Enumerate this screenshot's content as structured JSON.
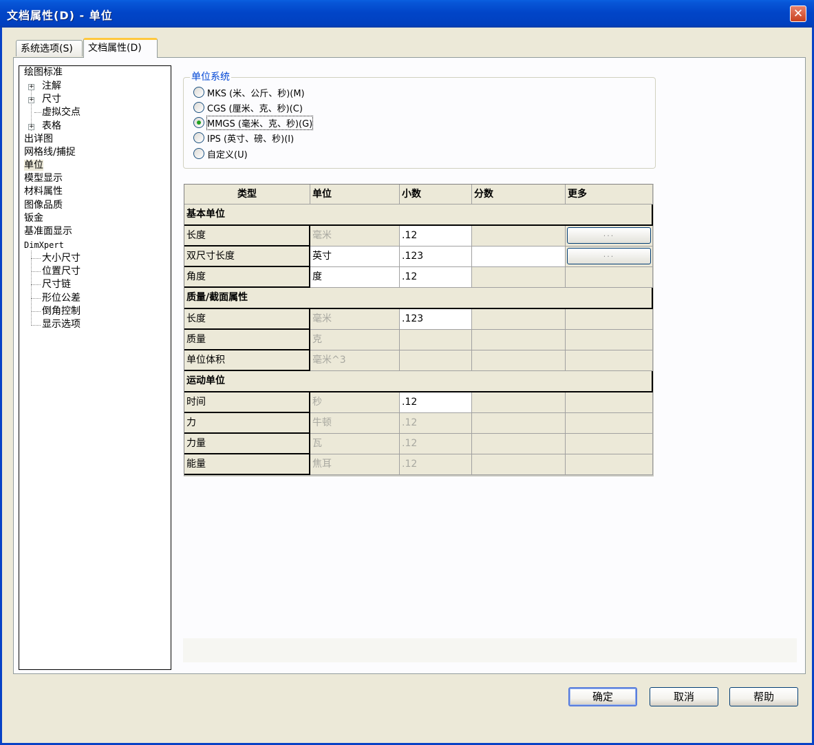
{
  "window": {
    "title": "文档属性(D) - 单位",
    "close_label": "✕"
  },
  "tabs": [
    {
      "label": "系统选项(S)",
      "active": false
    },
    {
      "label": "文档属性(D)",
      "active": true
    }
  ],
  "tree": {
    "items": [
      {
        "label": "绘图标准"
      },
      {
        "label": "注解"
      },
      {
        "label": "尺寸"
      },
      {
        "label": "虚拟交点"
      },
      {
        "label": "表格"
      },
      {
        "label": "出详图"
      },
      {
        "label": "网格线/捕捉"
      },
      {
        "label": "单位",
        "selected": true
      },
      {
        "label": "模型显示"
      },
      {
        "label": "材料属性"
      },
      {
        "label": "图像品质"
      },
      {
        "label": "钣金"
      },
      {
        "label": "基准面显示"
      },
      {
        "label": "DimXpert"
      },
      {
        "label": "大小尺寸"
      },
      {
        "label": "位置尺寸"
      },
      {
        "label": "尺寸链"
      },
      {
        "label": "形位公差"
      },
      {
        "label": "倒角控制"
      },
      {
        "label": "显示选项"
      }
    ],
    "expander_symbol": "+"
  },
  "unit_system": {
    "title": "单位系统",
    "options": [
      {
        "label": "MKS (米、公斤、秒)(M)"
      },
      {
        "label": "CGS (厘米、克、秒)(C)"
      },
      {
        "label": "MMGS (毫米、克、秒)(G)"
      },
      {
        "label": "IPS (英寸、磅、秒)(I)"
      },
      {
        "label": "自定义(U)"
      }
    ],
    "selected": "MMGS (毫米、克、秒)(G)"
  },
  "grid": {
    "headers": [
      "类型",
      "单位",
      "小数",
      "分数",
      "更多"
    ],
    "sections": [
      {
        "title": "基本单位"
      },
      {
        "title": "质量/截面属性"
      },
      {
        "title": "运动单位"
      }
    ],
    "rows": [
      {
        "type": "长度",
        "unit": "毫米",
        "decimal": ".12",
        "fraction": "",
        "more": "..."
      },
      {
        "type": "双尺寸长度",
        "unit": "英寸",
        "decimal": ".123",
        "fraction": "",
        "more": "..."
      },
      {
        "type": "角度",
        "unit": "度",
        "decimal": ".12",
        "fraction": "",
        "more": ""
      },
      {
        "type": "长度",
        "unit": "毫米",
        "decimal": ".123",
        "fraction": "",
        "more": ""
      },
      {
        "type": "质量",
        "unit": "克",
        "decimal": "",
        "fraction": "",
        "more": ""
      },
      {
        "type": "单位体积",
        "unit": "毫米^3",
        "decimal": "",
        "fraction": "",
        "more": ""
      },
      {
        "type": "时间",
        "unit": "秒",
        "decimal": ".12",
        "fraction": "",
        "more": ""
      },
      {
        "type": "力",
        "unit": "牛顿",
        "decimal": ".12",
        "fraction": "",
        "more": ""
      },
      {
        "type": "力量",
        "unit": "瓦",
        "decimal": ".12",
        "fraction": "",
        "more": ""
      },
      {
        "type": "能量",
        "unit": "焦耳",
        "decimal": ".12",
        "fraction": "",
        "more": ""
      }
    ]
  },
  "buttons": {
    "ok": "确定",
    "cancel": "取消",
    "help": "帮助"
  },
  "colors": {
    "titlebar": "#0145c8",
    "dialog_bg": "#ece9d8",
    "accent": "#0046d5",
    "radio_dot": "#21a121"
  }
}
